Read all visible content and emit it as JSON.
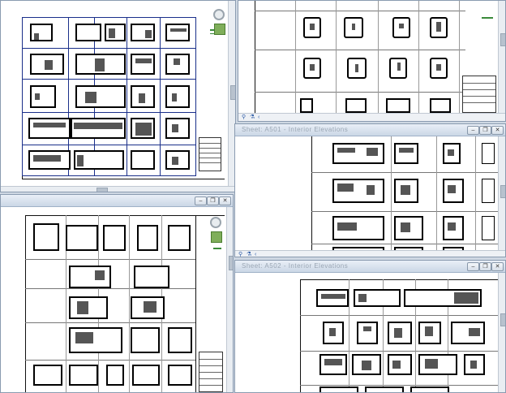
{
  "windows": [
    {
      "id": "top-left",
      "title": "",
      "state": "maximized-view"
    },
    {
      "id": "top-right",
      "title": ""
    },
    {
      "id": "mid-right",
      "title": "Sheet: A501 - Interior Elevations"
    },
    {
      "id": "bottom-left",
      "title": ""
    },
    {
      "id": "bottom-right",
      "title": "Sheet: A502 - Interior Elevations"
    }
  ],
  "window_buttons": {
    "minimize": "–",
    "restore": "❐",
    "close": "✕"
  },
  "icons": {
    "navigation_wheel": "navigation-wheel-icon",
    "zoom_tool": "zoom-tool-icon",
    "view_scale": "view-scale-icon",
    "detail_level": "detail-level-icon",
    "scroll_left": "scroll-left-arrow-icon"
  },
  "colors": {
    "selection_grid": "#1a2f8a",
    "nav_tool": "#7fae5a",
    "titlebar_top": "#e9eff7",
    "titlebar_bottom": "#cbd7e6"
  }
}
